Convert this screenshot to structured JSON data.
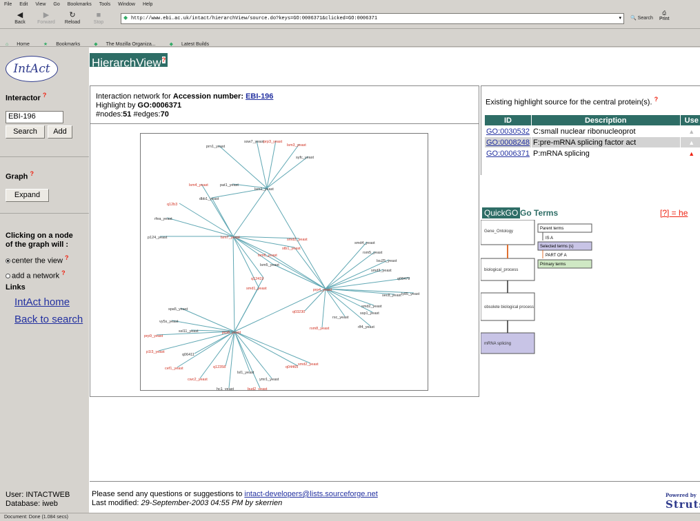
{
  "browser": {
    "menu": [
      "File",
      "Edit",
      "View",
      "Go",
      "Bookmarks",
      "Tools",
      "Window",
      "Help"
    ],
    "nav": {
      "back": "Back",
      "forward": "Forward",
      "reload": "Reload",
      "stop": "Stop",
      "search": "Search",
      "print": "Print"
    },
    "url": "http://www.ebi.ac.uk/intact/hierarchView/source.do?keys=GO:0006371&clicked=GO:0006371",
    "bookmarks": [
      "Home",
      "Bookmarks",
      "The Mozilla Organiza...",
      "Latest Builds"
    ],
    "status": "Document: Done (1.084 secs)"
  },
  "sidebar": {
    "logo": "IntAct",
    "interactor_heading": "Interactor",
    "interactor_value": "EBI-196",
    "search_label": "Search",
    "add_label": "Add",
    "graph_heading": "Graph",
    "expand_label": "Expand",
    "click_heading_1": "Clicking on a node",
    "click_heading_2": "of the graph will :",
    "option_center": "center the view",
    "option_add": "add a network",
    "links_heading": "Links",
    "link_home": "IntAct home",
    "link_back": "Back to search",
    "user": "User: INTACTWEB",
    "database": "Database: iweb"
  },
  "page_title": "HierarchView",
  "info": {
    "line1_prefix": "Interaction network for",
    "line1_bold": "Accession number:",
    "accession": "EBI-196",
    "line2_prefix": "Highlight by",
    "highlight": "GO:0006371",
    "nodes_label": "#nodes:",
    "nodes": "51",
    "edges_label": "#edges:",
    "edges": "70"
  },
  "highlight_source": {
    "title": "Existing highlight source for the central protein(s).",
    "headers": [
      "ID",
      "Description",
      "Use"
    ],
    "rows": [
      {
        "id": "GO:0030532",
        "desc": "C:small nuclear ribonucleoprot"
      },
      {
        "id": "GO:0008248",
        "desc": "F:pre-mRNA splicing factor act"
      },
      {
        "id": "GO:0006371",
        "desc": "P:mRNA splicing"
      }
    ]
  },
  "quickgo": {
    "tag": "QuickGO",
    "terms": "Go Terms",
    "help": "[?] = he",
    "legend": [
      "Parent terms",
      "IS A",
      "Selected terms (s)",
      "PART OF A",
      "Primary terms"
    ],
    "boxes": [
      "Gene_Ontology",
      "biological_process",
      "obsolete biological process",
      "mRNA splicing"
    ]
  },
  "graph": {
    "nodes": [
      {
        "label": "ssw7_yeast",
        "hl": false
      },
      {
        "label": "prp3_yeast",
        "hl": true
      },
      {
        "label": "prn1_yeast",
        "hl": false
      },
      {
        "label": "lsm3_yeast",
        "hl": true
      },
      {
        "label": "syfc_yeast",
        "hl": false
      },
      {
        "label": "lsm4_yeast",
        "hl": true
      },
      {
        "label": "pat1_yeast",
        "hl": false
      },
      {
        "label": "lsm1_yeast",
        "hl": false
      },
      {
        "label": "dbb1_yeast",
        "hl": false
      },
      {
        "label": "q12b3",
        "hl": true
      },
      {
        "label": "rfea_yeast",
        "hl": false
      },
      {
        "label": "p124_yeast",
        "hl": false
      },
      {
        "label": "lsm7_yeast",
        "hl": true
      },
      {
        "label": "smd2_yeast",
        "hl": true
      },
      {
        "label": "stb1_yeast",
        "hl": true
      },
      {
        "label": "lsm6_yeast",
        "hl": true
      },
      {
        "label": "lsm5_yeast",
        "hl": false
      },
      {
        "label": "smd4_yeast",
        "hl": false
      },
      {
        "label": "rsm5_yeast",
        "hl": false
      },
      {
        "label": "lsu25_yeast",
        "hl": false
      },
      {
        "label": "smd3_yeast",
        "hl": false
      },
      {
        "label": "q08479",
        "hl": false
      },
      {
        "label": "prp4_yeast",
        "hl": true
      },
      {
        "label": "q12419",
        "hl": true
      },
      {
        "label": "sec8_yeast",
        "hl": false
      },
      {
        "label": "ly85_yeast",
        "hl": false
      },
      {
        "label": "smd1_yeast",
        "hl": true
      },
      {
        "label": "smd2_yeast",
        "hl": false
      },
      {
        "label": "ssp1_yeast",
        "hl": false
      },
      {
        "label": "rsc_yeast",
        "hl": false
      },
      {
        "label": "q03230",
        "hl": true
      },
      {
        "label": "rsm8_yeast",
        "hl": true
      },
      {
        "label": "rlf4_yeast",
        "hl": false
      },
      {
        "label": "spa5_yeast",
        "hl": false
      },
      {
        "label": "vy5s_yeast",
        "hl": false
      },
      {
        "label": "prp9_yeast",
        "hl": true
      },
      {
        "label": "ssl11_yeast",
        "hl": false
      },
      {
        "label": "prp8_yeast",
        "hl": true
      },
      {
        "label": "p1l3_yeast",
        "hl": true
      },
      {
        "label": "q06411",
        "hl": false
      },
      {
        "label": "cef1_yeast",
        "hl": true
      },
      {
        "label": "q12358",
        "hl": true
      },
      {
        "label": "lsl1_yeast",
        "hl": false
      },
      {
        "label": "q04465",
        "hl": true
      },
      {
        "label": "smd2_yeast",
        "hl": true
      },
      {
        "label": "ymr1_yeast",
        "hl": false
      },
      {
        "label": "cwc2_yeast",
        "hl": true
      },
      {
        "label": "hc1_yeast",
        "hl": false
      },
      {
        "label": "bud2_yeast",
        "hl": true
      }
    ]
  }
}
